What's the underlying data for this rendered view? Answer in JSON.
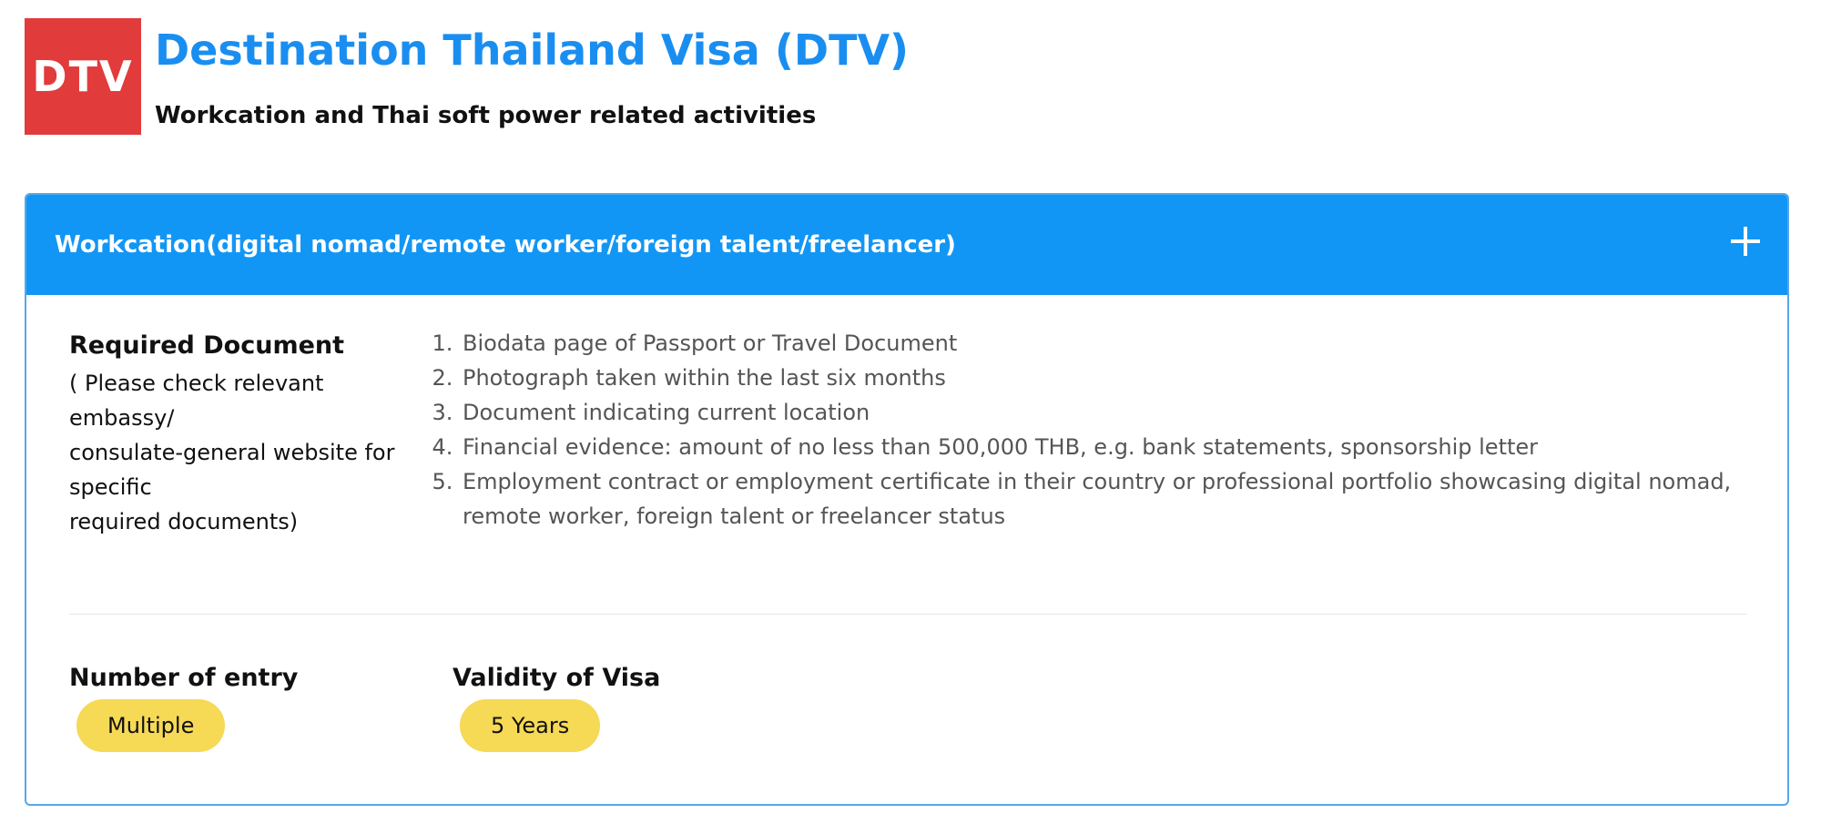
{
  "header": {
    "logo_text": "DTV",
    "title": "Destination Thailand Visa (DTV)",
    "subtitle": "Workcation and Thai soft power related activities"
  },
  "panel": {
    "title": "Workcation(digital nomad/remote worker/foreign talent/freelancer)",
    "toggle_icon": "plus-icon",
    "required_document": {
      "label": "Required Document",
      "note_lines": [
        "( Please check relevant embassy/",
        "consulate-general website for",
        "specific",
        "required documents)"
      ],
      "items": [
        "Biodata page of Passport or Travel Document",
        "Photograph taken within the last six months",
        "Document indicating current location",
        "Financial evidence: amount of no less than 500,000 THB, e.g. bank statements, sponsorship letter",
        "Employment contract or employment certificate in their country or professional portfolio showcasing digital nomad, remote worker, foreign talent or freelancer status"
      ]
    },
    "number_of_entry": {
      "label": "Number of entry",
      "value": "Multiple"
    },
    "validity": {
      "label": "Validity of Visa",
      "value": "5 Years"
    }
  },
  "colors": {
    "brand_blue": "#1296f5",
    "title_blue": "#1a8ef0",
    "logo_red": "#e23b3b",
    "badge_yellow": "#f6d955"
  }
}
